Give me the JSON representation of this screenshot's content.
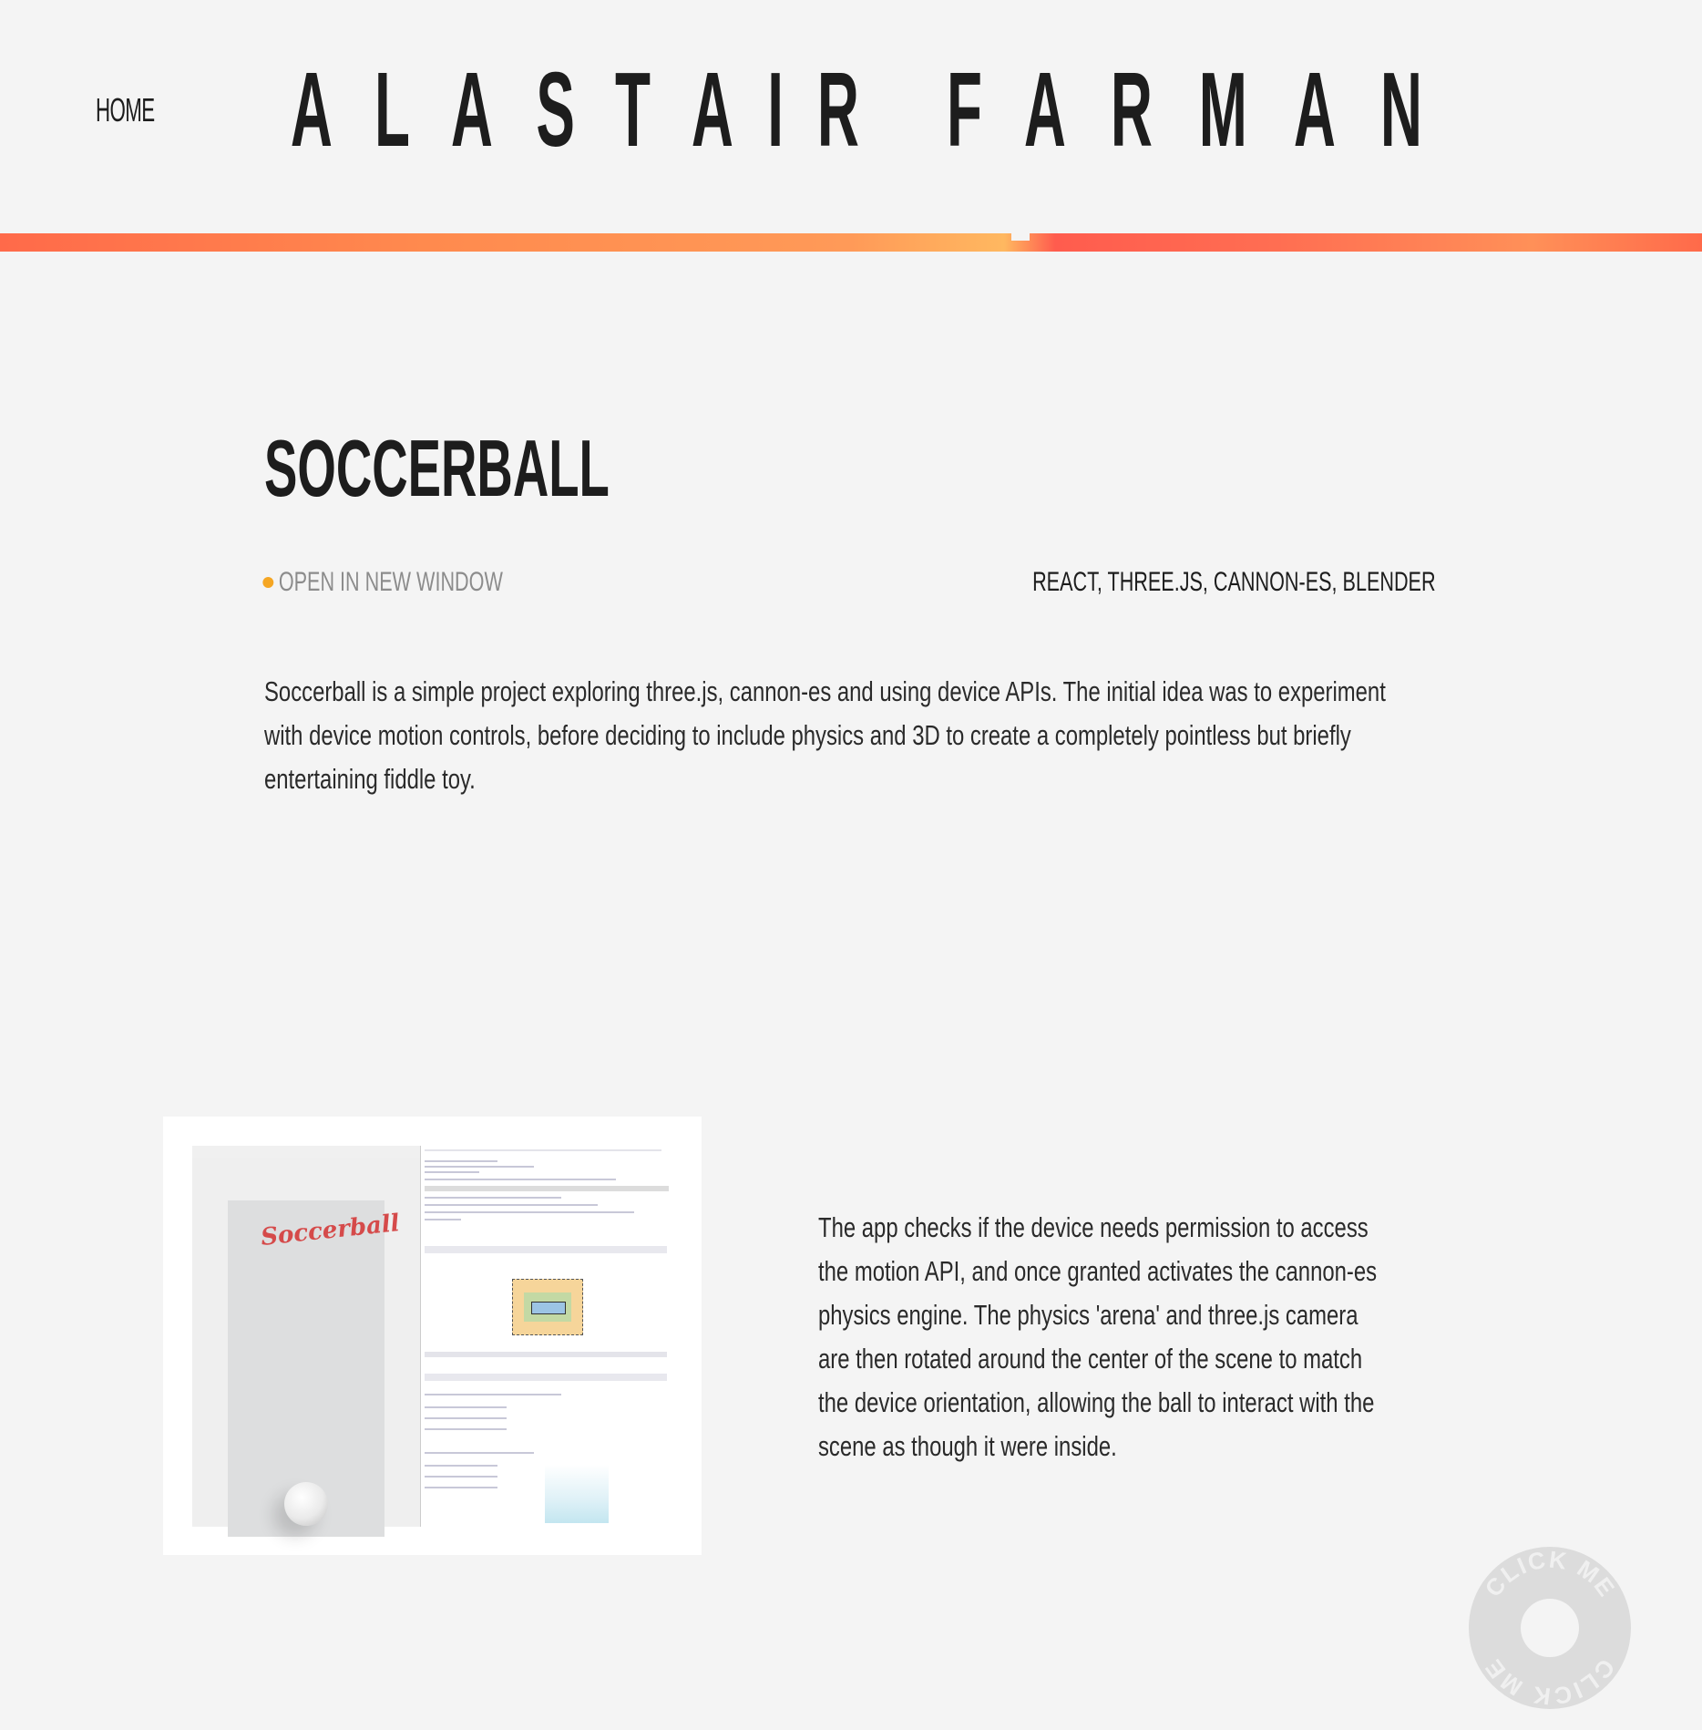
{
  "header": {
    "home_label": "HOME",
    "site_title_letters": [
      "A",
      "L",
      "A",
      "S",
      "T",
      "A",
      "I",
      "R",
      "F",
      "A",
      "R",
      "M",
      "A",
      "N"
    ]
  },
  "project": {
    "title": "SOCCERBALL",
    "open_link_label": "OPEN IN NEW WINDOW",
    "tech": "REACT, THREE.JS, CANNON-ES, BLENDER",
    "intro": "Soccerball is a simple project exploring three.js, cannon-es and using device APIs. The initial idea was to experiment with device motion controls, before deciding to include physics and 3D to create a completely pointless but briefly entertaining fiddle toy.",
    "screenshot_logo": "Soccerball",
    "description": "The app checks if the device needs permission to access the motion API, and once granted activates the cannon-es physics engine. The physics 'arena' and three.js camera are then rotated around the center of the scene to match the device orientation, allowing the ball to interact with the scene as though it were inside."
  },
  "click_badge": {
    "label": "CLICK ME"
  },
  "colors": {
    "background": "#f4f4f4",
    "text": "#1d1d1d",
    "accent_dot": "#f5a623",
    "muted": "#8c8c8c",
    "gradient_start": "#ff6a4a",
    "gradient_mid": "#ffb860",
    "logo_red": "#d54a4a"
  }
}
